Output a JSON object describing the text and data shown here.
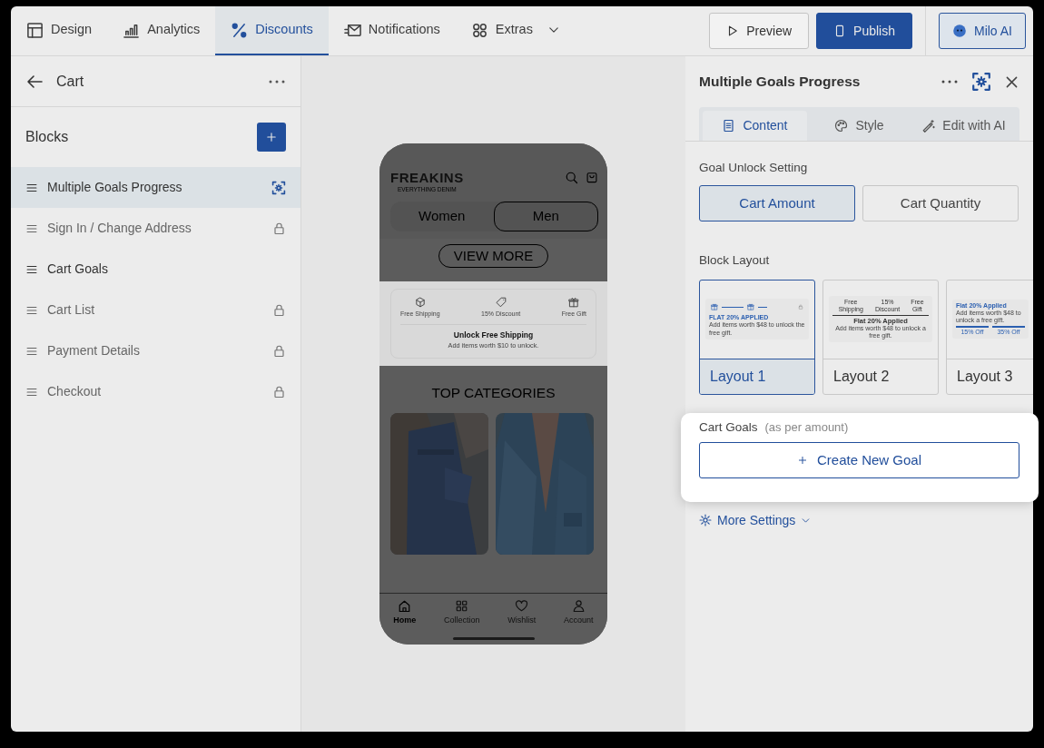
{
  "top_bar": {
    "tabs": [
      {
        "label": "Design",
        "selected": false,
        "dropdown": false
      },
      {
        "label": "Analytics",
        "selected": false,
        "dropdown": false
      },
      {
        "label": "Discounts",
        "selected": true,
        "dropdown": false
      },
      {
        "label": "Notifications",
        "selected": false,
        "dropdown": false
      },
      {
        "label": "Extras",
        "selected": false,
        "dropdown": true
      }
    ],
    "buttons": [
      {
        "label": "Preview",
        "kind": "outline"
      },
      {
        "label": "Publish",
        "kind": "primary"
      },
      {
        "label": "Milo AI",
        "kind": "assistant"
      }
    ]
  },
  "left_panel": {
    "title": "Cart",
    "section_title": "Blocks",
    "blocks": [
      {
        "label": "Multiple Goals Progress",
        "selected": true,
        "locked": false
      },
      {
        "label": "Sign In / Change Address",
        "selected": false,
        "locked": true
      },
      {
        "label": "Cart Goals",
        "selected": false,
        "locked": false
      },
      {
        "label": "Cart List",
        "selected": false,
        "locked": true
      },
      {
        "label": "Payment Details",
        "selected": false,
        "locked": true
      },
      {
        "label": "Checkout",
        "selected": false,
        "locked": true
      }
    ]
  },
  "preview": {
    "brand": "FREAKINS",
    "tagline": "EVERYTHING DENIM",
    "gender_tabs": [
      {
        "label": "Women",
        "selected": false
      },
      {
        "label": "Men",
        "selected": true
      }
    ],
    "view_more": "VIEW MORE",
    "goals": [
      {
        "label": "Free Shipping"
      },
      {
        "label": "15% Discount"
      },
      {
        "label": "Free Gift"
      }
    ],
    "goal_title": "Unlock Free Shipping",
    "goal_message": "Add items worth $10 to unlock.",
    "categories_title": "TOP CATEGORIES",
    "bottom_nav": [
      {
        "label": "Home",
        "selected": true
      },
      {
        "label": "Collection",
        "selected": false
      },
      {
        "label": "Wishlist",
        "selected": false
      },
      {
        "label": "Account",
        "selected": false
      }
    ]
  },
  "right_panel": {
    "title": "Multiple Goals Progress",
    "tabs": [
      {
        "label": "Content",
        "selected": true
      },
      {
        "label": "Style",
        "selected": false
      },
      {
        "label": "Edit with AI",
        "selected": false
      }
    ],
    "unlock_label": "Goal Unlock Setting",
    "unlock_options": [
      {
        "label": "Cart Amount",
        "selected": true
      },
      {
        "label": "Cart Quantity",
        "selected": false
      }
    ],
    "layout_label": "Block Layout",
    "layouts": [
      {
        "label": "Layout 1",
        "selected": true,
        "kind": "icons",
        "title": "FLAT 20% APPLIED",
        "message": "Add items worth $48 to unlock the free gift."
      },
      {
        "label": "Layout 2",
        "selected": false,
        "kind": "steps",
        "steps": [
          "Free Shipping",
          "15% Discount",
          "Free Gift"
        ],
        "title": "Flat 20% Applied",
        "message": "Add items worth $48 to unlock a free gift."
      },
      {
        "label": "Layout 3",
        "selected": false,
        "kind": "bars",
        "title": "Flat 20% Applied",
        "message": "Add items worth $48 to unlock a free gift.",
        "steps": [
          "15% Off",
          "35% Off"
        ]
      }
    ],
    "goals_label": "Cart Goals",
    "goals_hint": "(as per amount)",
    "create_button": "Create New Goal",
    "more_settings": "More Settings"
  }
}
